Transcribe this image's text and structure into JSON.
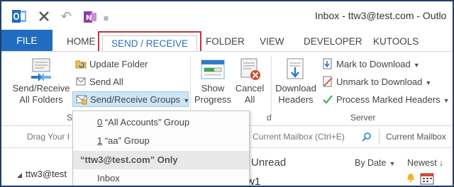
{
  "window": {
    "title": "Inbox - ttw3@test.com - Outlo"
  },
  "qat": {
    "undo_glyph": "↶",
    "dropdown_glyph": "≡"
  },
  "tabs": {
    "file": "FILE",
    "home": "HOME",
    "send_receive": "SEND / RECEIVE",
    "folder": "FOLDER",
    "view": "VIEW",
    "developer": "DEVELOPER",
    "kutools": "KUTOOLS"
  },
  "ribbon": {
    "send_receive_all": [
      "Send/Receive",
      "All Folders"
    ],
    "update_folder": "Update Folder",
    "send_all": "Send All",
    "send_receive_groups": "Send/Receive Groups",
    "group_label_left": "S",
    "show_progress": [
      "Show",
      "Progress"
    ],
    "cancel_all": [
      "Cancel",
      "All"
    ],
    "group_label_mid": "d",
    "download_headers": [
      "Download",
      "Headers"
    ],
    "mark_to_download": "Mark to Download",
    "unmark_to_download": "Unmark to Download",
    "process_marked_headers": "Process Marked Headers",
    "group_label_server": "Server"
  },
  "search": {
    "drag_text": "Drag Your I",
    "current_mailbox_text": "h Current Mailbox (Ctrl+E)",
    "current_mailbox_scope": "Current Mailbox"
  },
  "list": {
    "unread": "Unread",
    "by_date": "By Date",
    "newest": "Newest",
    "ttw_fragment": "w1"
  },
  "tree": {
    "account": "ttw3@test"
  },
  "menu": {
    "items": [
      {
        "accel": "0",
        "label": " “All Accounts” Group"
      },
      {
        "accel": "1",
        "label": " “aa” Group"
      }
    ],
    "header": "“ttw3@test.com” Only",
    "inbox": "Inbox"
  },
  "colors": {
    "accent": "#1f6cc1",
    "highlight_border": "#c4323a",
    "active_tab_text": "#2a6fbd"
  },
  "icons": [
    "outlook-icon",
    "close-icon",
    "undo-icon",
    "onenote-icon",
    "qat-dropdown-icon",
    "send-receive-icon",
    "update-folder-icon",
    "send-all-icon",
    "groups-icon",
    "progress-icon",
    "cancel-icon",
    "download-headers-icon",
    "mark-download-icon",
    "unmark-download-icon",
    "process-headers-icon",
    "search-icon",
    "dropdown-arrow-icon",
    "bell-icon",
    "calendar-icon"
  ]
}
